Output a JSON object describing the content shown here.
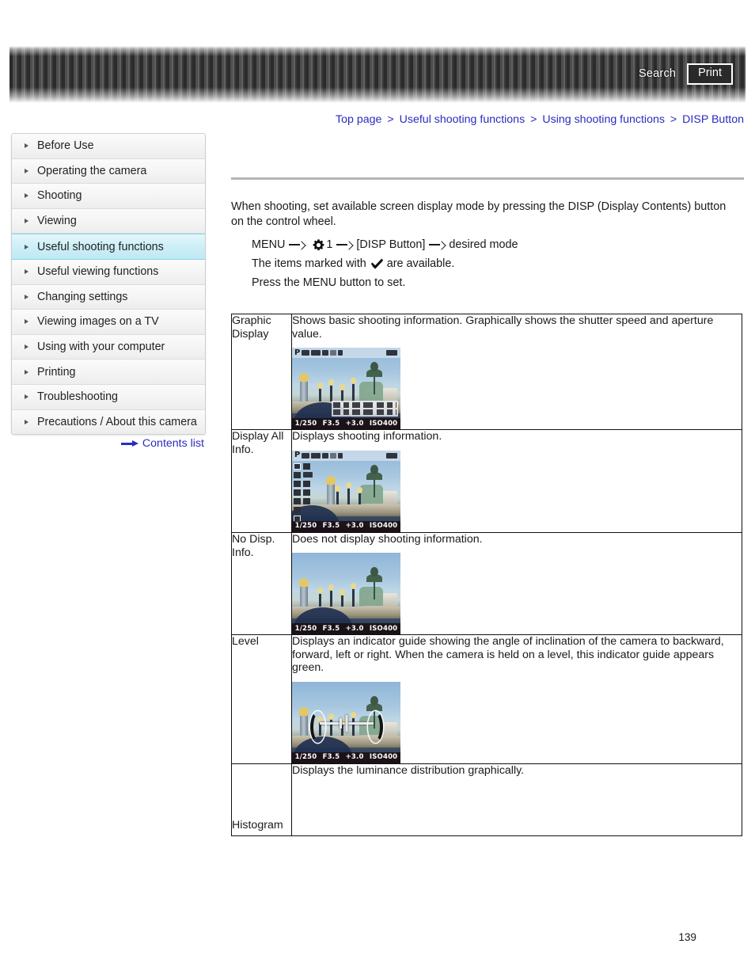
{
  "header": {
    "search_label": "Search",
    "print_label": "Print"
  },
  "breadcrumb": {
    "separator": ">",
    "items": [
      "Top page",
      "Useful shooting functions",
      "Using shooting functions",
      "DISP Button"
    ]
  },
  "sidebar": {
    "items": [
      {
        "label": "Before Use",
        "active": false
      },
      {
        "label": "Operating the camera",
        "active": false
      },
      {
        "label": "Shooting",
        "active": false
      },
      {
        "label": "Viewing",
        "active": false
      },
      {
        "label": "Useful shooting functions",
        "active": true
      },
      {
        "label": "Useful viewing functions",
        "active": false
      },
      {
        "label": "Changing settings",
        "active": false
      },
      {
        "label": "Viewing images on a TV",
        "active": false
      },
      {
        "label": "Using with your computer",
        "active": false
      },
      {
        "label": "Printing",
        "active": false
      },
      {
        "label": "Troubleshooting",
        "active": false
      },
      {
        "label": "Precautions / About this camera",
        "active": false
      }
    ],
    "contents_list_label": "Contents list",
    "active_highlight_color": "#cdeff7"
  },
  "main": {
    "intro": "When shooting, set available screen display mode by pressing the DISP (Display Contents) button on the control wheel.",
    "steps": {
      "menu_label": "MENU",
      "setup_tab_number": "1",
      "disp_button_label": "[DISP Button]",
      "desired_mode_label": "desired mode",
      "marked_prefix": "The items marked with",
      "marked_suffix": "are available.",
      "press_menu": "Press the MENU button to set."
    }
  },
  "table": {
    "rows": [
      {
        "mode": "Graphic Display",
        "description": "Shows basic shooting information. Graphically shows the shutter speed and aperture value.",
        "screen": {
          "mode_indicator": "P",
          "shutter": "1/250",
          "aperture": "F3.5",
          "exposure": "+3.0",
          "iso": "ISO400"
        }
      },
      {
        "mode": "Display All Info.",
        "description": "Displays shooting information.",
        "screen": {
          "mode_indicator": "P",
          "shutter": "1/250",
          "aperture": "F3.5",
          "exposure": "+3.0",
          "iso": "ISO400"
        }
      },
      {
        "mode": "No Disp. Info.",
        "description": "Does not display shooting information.",
        "screen": {
          "mode_indicator": "",
          "shutter": "1/250",
          "aperture": "F3.5",
          "exposure": "+3.0",
          "iso": "ISO400"
        }
      },
      {
        "mode": "Level",
        "description": "Displays an indicator guide showing the angle of inclination of the camera to backward, forward, left or right. When the camera is held on a level, this indicator guide appears green.",
        "screen": {
          "mode_indicator": "",
          "shutter": "1/250",
          "aperture": "F3.5",
          "exposure": "+3.0",
          "iso": "ISO400"
        }
      },
      {
        "mode": "Histogram",
        "description": "Displays the luminance distribution graphically.",
        "screen": null
      }
    ]
  },
  "footer": {
    "page_number": "139"
  }
}
